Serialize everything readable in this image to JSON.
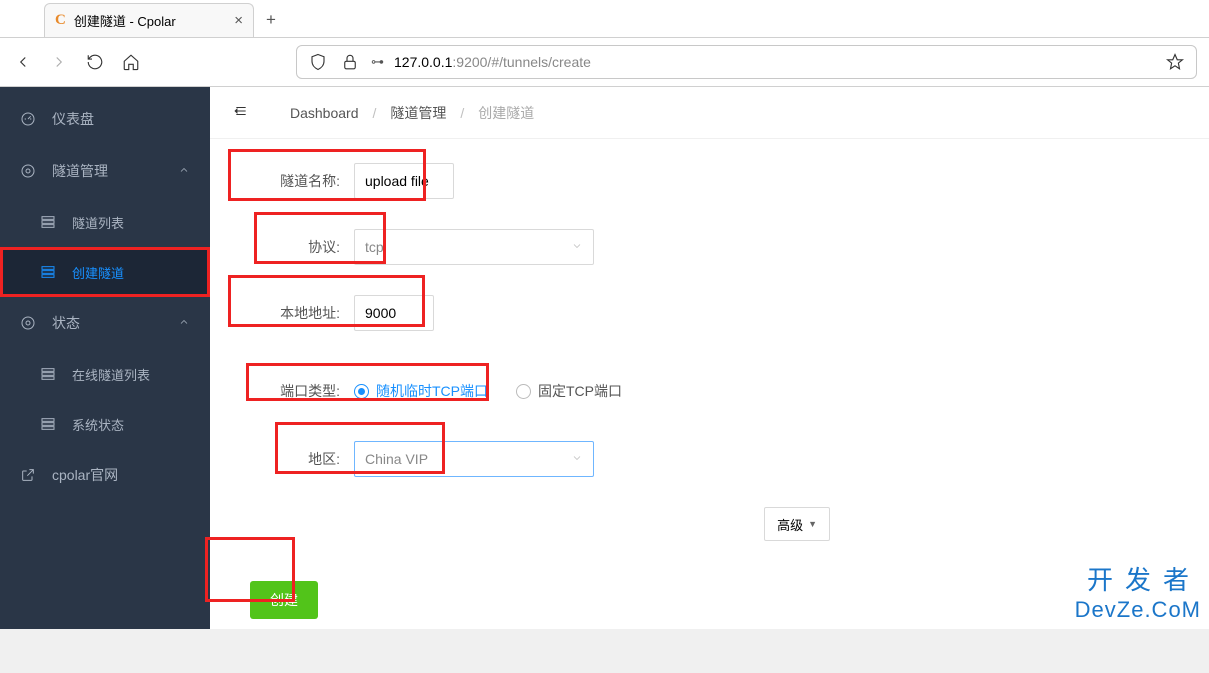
{
  "browser": {
    "tab_title": "创建隧道 - Cpolar",
    "url_prefix": "127.0.0.1",
    "url_suffix": ":9200/#/tunnels/create"
  },
  "sidebar": {
    "dashboard": "仪表盘",
    "tunnel_mgmt": "隧道管理",
    "tunnel_list": "隧道列表",
    "create_tunnel": "创建隧道",
    "status": "状态",
    "online_tunnels": "在线隧道列表",
    "sys_status": "系统状态",
    "cpolar_site": "cpolar官网"
  },
  "breadcrumb": {
    "a": "Dashboard",
    "b": "隧道管理",
    "c": "创建隧道"
  },
  "form": {
    "tunnel_name_label": "隧道名称:",
    "tunnel_name_value": "upload file",
    "protocol_label": "协议:",
    "protocol_value": "tcp",
    "local_addr_label": "本地地址:",
    "local_addr_value": "9000",
    "port_type_label": "端口类型:",
    "port_type_random": "随机临时TCP端口",
    "port_type_fixed": "固定TCP端口",
    "region_label": "地区:",
    "region_value": "China VIP",
    "advanced_btn": "高级",
    "create_btn": "创建"
  },
  "watermark": {
    "top": "开发者",
    "bottom": "DevZe.CoM"
  }
}
